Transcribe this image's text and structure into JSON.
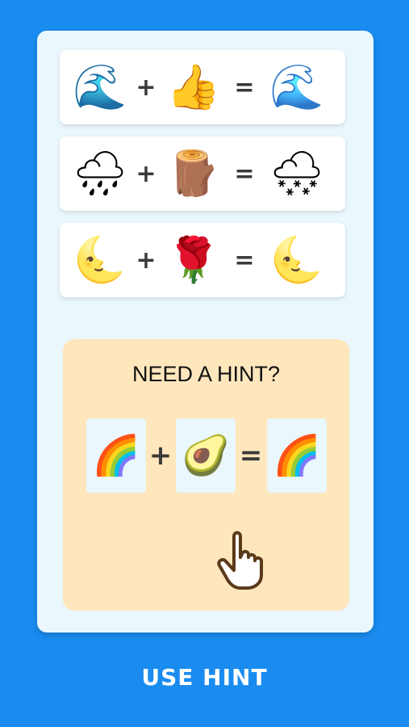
{
  "equations": [
    {
      "left": "🌊",
      "op1": "+",
      "right": "👍",
      "op2": "=",
      "result": "🌊",
      "result_icon": "wave-thumbs-up-icon"
    },
    {
      "left": "🌧",
      "op1": "+",
      "right": "🪵",
      "op2": "=",
      "result": "🌨",
      "result_icon": "cloud-raining-logs-icon"
    },
    {
      "left": "🌜",
      "op1": "+",
      "right": "🌹",
      "op2": "=",
      "result": "🌜",
      "result_icon": "moon-holding-rose-icon"
    }
  ],
  "hint": {
    "title": "NEED A HINT?",
    "left": "🌈",
    "op1": "+",
    "right": "🥑",
    "op2": "=",
    "result": "🌈",
    "result_icon": "rainbow-avocado-icon"
  },
  "use_hint_label": "USE HINT",
  "colors": {
    "background": "#1a8cf0",
    "card": "#eaf7fc",
    "hint_panel": "#fee6bd"
  }
}
